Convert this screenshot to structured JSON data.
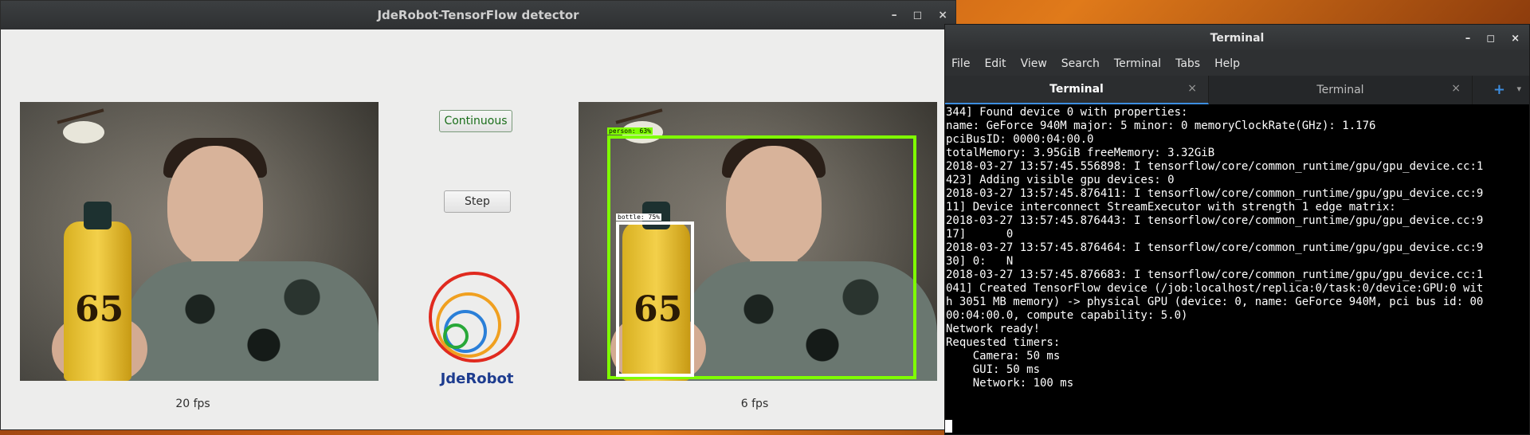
{
  "detector": {
    "title": "JdeRobot-TensorFlow detector",
    "controls": {
      "minimize": "–",
      "maximize": "◻",
      "close": "×"
    },
    "buttons": {
      "continuous": "Continuous",
      "step": "Step"
    },
    "left_fps": "20 fps",
    "right_fps": "6 fps",
    "logo_text": "JdeRobot",
    "bottle_text": "65",
    "detections": [
      {
        "label": "person: 63%",
        "color": "#7fff00"
      },
      {
        "label": "bottle: 75%",
        "color": "#ffffff"
      }
    ]
  },
  "terminal": {
    "title": "Terminal",
    "controls": {
      "minimize": "–",
      "maximize": "◻",
      "close": "×"
    },
    "menu": [
      "File",
      "Edit",
      "View",
      "Search",
      "Terminal",
      "Tabs",
      "Help"
    ],
    "tabs": [
      {
        "label": "Terminal",
        "active": true
      },
      {
        "label": "Terminal",
        "active": false
      }
    ],
    "tab_close": "×",
    "new_tab": "+",
    "tab_menu": "▾",
    "lines": [
      "344] Found device 0 with properties:",
      "name: GeForce 940M major: 5 minor: 0 memoryClockRate(GHz): 1.176",
      "pciBusID: 0000:04:00.0",
      "totalMemory: 3.95GiB freeMemory: 3.32GiB",
      "2018-03-27 13:57:45.556898: I tensorflow/core/common_runtime/gpu/gpu_device.cc:1",
      "423] Adding visible gpu devices: 0",
      "2018-03-27 13:57:45.876411: I tensorflow/core/common_runtime/gpu/gpu_device.cc:9",
      "11] Device interconnect StreamExecutor with strength 1 edge matrix:",
      "2018-03-27 13:57:45.876443: I tensorflow/core/common_runtime/gpu/gpu_device.cc:9",
      "17]      0",
      "2018-03-27 13:57:45.876464: I tensorflow/core/common_runtime/gpu/gpu_device.cc:9",
      "30] 0:   N",
      "2018-03-27 13:57:45.876683: I tensorflow/core/common_runtime/gpu/gpu_device.cc:1",
      "041] Created TensorFlow device (/job:localhost/replica:0/task:0/device:GPU:0 wit",
      "h 3051 MB memory) -> physical GPU (device: 0, name: GeForce 940M, pci bus id: 00",
      "00:04:00.0, compute capability: 5.0)",
      "Network ready!",
      "",
      "Requested timers:",
      "    Camera: 50 ms",
      "    GUI: 50 ms",
      "    Network: 100 ms"
    ]
  }
}
